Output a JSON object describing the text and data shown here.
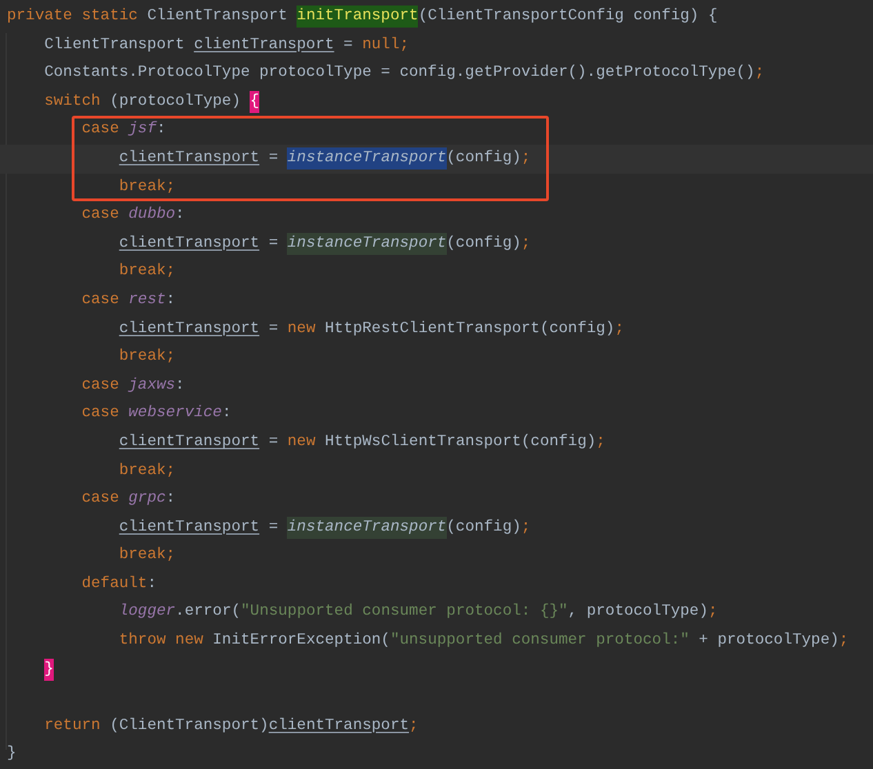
{
  "editor": {
    "lines": [
      {
        "kind": "code",
        "tokens": [
          {
            "kind": "keyword",
            "text": "private static "
          },
          {
            "kind": "plain",
            "text": "ClientTransport "
          },
          {
            "kind": "plain",
            "text": "initTransport",
            "declaration_highlight": true
          },
          {
            "kind": "plain",
            "text": "(ClientTransportConfig config) {"
          }
        ],
        "children": [
          {
            "kind": "code",
            "tokens": [
              {
                "kind": "plain",
                "text": "ClientTransport "
              },
              {
                "kind": "variable",
                "text": "clientTransport"
              },
              {
                "kind": "plain",
                "text": " = "
              },
              {
                "kind": "keyword",
                "text": "null;"
              }
            ]
          },
          {
            "kind": "code",
            "tokens": [
              {
                "kind": "plain",
                "text": "Constants.ProtocolType protocolType = config.getProvider().getProtocolType()"
              },
              {
                "kind": "keyword",
                "text": ";"
              }
            ]
          },
          {
            "kind": "code",
            "tokens": [
              {
                "kind": "keyword",
                "text": "switch"
              },
              {
                "kind": "plain",
                "text": " (protocolType) "
              },
              {
                "kind": "plain",
                "text": "{",
                "matched_brace": true
              }
            ],
            "children": [
              {
                "kind": "code",
                "boxed": true,
                "tokens": [
                  {
                    "kind": "keyword",
                    "text": "case "
                  },
                  {
                    "kind": "constant",
                    "text": "jsf"
                  },
                  {
                    "kind": "plain",
                    "text": ":"
                  }
                ],
                "children": [
                  {
                    "kind": "code",
                    "boxed": true,
                    "current": true,
                    "tokens": [
                      {
                        "kind": "variable",
                        "text": "clientTransport"
                      },
                      {
                        "kind": "plain",
                        "text": " = "
                      },
                      {
                        "kind": "static-call",
                        "text": "instanceTransport",
                        "text_selected": true
                      },
                      {
                        "kind": "plain",
                        "text": "(config)"
                      },
                      {
                        "kind": "keyword",
                        "text": ";"
                      }
                    ]
                  },
                  {
                    "kind": "code",
                    "boxed": true,
                    "tokens": [
                      {
                        "kind": "keyword",
                        "text": "break;"
                      }
                    ]
                  }
                ]
              },
              {
                "kind": "code",
                "tokens": [
                  {
                    "kind": "keyword",
                    "text": "case "
                  },
                  {
                    "kind": "constant",
                    "text": "dubbo"
                  },
                  {
                    "kind": "plain",
                    "text": ":"
                  }
                ],
                "children": [
                  {
                    "kind": "code",
                    "tokens": [
                      {
                        "kind": "variable",
                        "text": "clientTransport"
                      },
                      {
                        "kind": "plain",
                        "text": " = "
                      },
                      {
                        "kind": "static-call",
                        "text": "instanceTransport",
                        "usage_highlight": true
                      },
                      {
                        "kind": "plain",
                        "text": "(config)"
                      },
                      {
                        "kind": "keyword",
                        "text": ";"
                      }
                    ]
                  },
                  {
                    "kind": "code",
                    "tokens": [
                      {
                        "kind": "keyword",
                        "text": "break;"
                      }
                    ]
                  }
                ]
              },
              {
                "kind": "code",
                "tokens": [
                  {
                    "kind": "keyword",
                    "text": "case "
                  },
                  {
                    "kind": "constant",
                    "text": "rest"
                  },
                  {
                    "kind": "plain",
                    "text": ":"
                  }
                ],
                "children": [
                  {
                    "kind": "code",
                    "tokens": [
                      {
                        "kind": "variable",
                        "text": "clientTransport"
                      },
                      {
                        "kind": "plain",
                        "text": " = "
                      },
                      {
                        "kind": "keyword",
                        "text": "new "
                      },
                      {
                        "kind": "plain",
                        "text": "HttpRestClientTransport(config)"
                      },
                      {
                        "kind": "keyword",
                        "text": ";"
                      }
                    ]
                  },
                  {
                    "kind": "code",
                    "tokens": [
                      {
                        "kind": "keyword",
                        "text": "break;"
                      }
                    ]
                  }
                ]
              },
              {
                "kind": "code",
                "tokens": [
                  {
                    "kind": "keyword",
                    "text": "case "
                  },
                  {
                    "kind": "constant",
                    "text": "jaxws"
                  },
                  {
                    "kind": "plain",
                    "text": ":"
                  }
                ]
              },
              {
                "kind": "code",
                "tokens": [
                  {
                    "kind": "keyword",
                    "text": "case "
                  },
                  {
                    "kind": "constant",
                    "text": "webservice"
                  },
                  {
                    "kind": "plain",
                    "text": ":"
                  }
                ],
                "children": [
                  {
                    "kind": "code",
                    "tokens": [
                      {
                        "kind": "variable",
                        "text": "clientTransport"
                      },
                      {
                        "kind": "plain",
                        "text": " = "
                      },
                      {
                        "kind": "keyword",
                        "text": "new "
                      },
                      {
                        "kind": "plain",
                        "text": "HttpWsClientTransport(config)"
                      },
                      {
                        "kind": "keyword",
                        "text": ";"
                      }
                    ]
                  },
                  {
                    "kind": "code",
                    "tokens": [
                      {
                        "kind": "keyword",
                        "text": "break;"
                      }
                    ]
                  }
                ]
              },
              {
                "kind": "code",
                "tokens": [
                  {
                    "kind": "keyword",
                    "text": "case "
                  },
                  {
                    "kind": "constant",
                    "text": "grpc"
                  },
                  {
                    "kind": "plain",
                    "text": ":"
                  }
                ],
                "children": [
                  {
                    "kind": "code",
                    "tokens": [
                      {
                        "kind": "variable",
                        "text": "clientTransport"
                      },
                      {
                        "kind": "plain",
                        "text": " = "
                      },
                      {
                        "kind": "static-call",
                        "text": "instanceTransport",
                        "usage_highlight": true
                      },
                      {
                        "kind": "plain",
                        "text": "(config)"
                      },
                      {
                        "kind": "keyword",
                        "text": ";"
                      }
                    ]
                  },
                  {
                    "kind": "code",
                    "tokens": [
                      {
                        "kind": "keyword",
                        "text": "break;"
                      }
                    ]
                  }
                ]
              },
              {
                "kind": "code",
                "tokens": [
                  {
                    "kind": "keyword",
                    "text": "default"
                  },
                  {
                    "kind": "plain",
                    "text": ":"
                  }
                ],
                "children": [
                  {
                    "kind": "code",
                    "tokens": [
                      {
                        "kind": "constant",
                        "text": "logger"
                      },
                      {
                        "kind": "plain",
                        "text": ".error("
                      },
                      {
                        "kind": "string",
                        "text": "\"Unsupported consumer protocol: {}\""
                      },
                      {
                        "kind": "plain",
                        "text": ", protocolType)"
                      },
                      {
                        "kind": "keyword",
                        "text": ";"
                      }
                    ]
                  },
                  {
                    "kind": "code",
                    "tokens": [
                      {
                        "kind": "keyword",
                        "text": "throw new "
                      },
                      {
                        "kind": "plain",
                        "text": "InitErrorException("
                      },
                      {
                        "kind": "string",
                        "text": "\"unsupported consumer protocol:\""
                      },
                      {
                        "kind": "plain",
                        "text": " + protocolType)"
                      },
                      {
                        "kind": "keyword",
                        "text": ";"
                      }
                    ]
                  }
                ]
              }
            ]
          },
          {
            "kind": "code",
            "tokens": [
              {
                "kind": "plain",
                "text": "}",
                "matched_brace": true
              }
            ]
          },
          {
            "kind": "blank"
          },
          {
            "kind": "code",
            "tokens": [
              {
                "kind": "keyword",
                "text": "return "
              },
              {
                "kind": "plain",
                "text": "(ClientTransport)"
              },
              {
                "kind": "variable",
                "text": "clientTransport"
              },
              {
                "kind": "keyword",
                "text": ";"
              }
            ]
          }
        ]
      },
      {
        "kind": "code",
        "tokens": [
          {
            "kind": "plain",
            "text": "}"
          }
        ]
      }
    ]
  }
}
